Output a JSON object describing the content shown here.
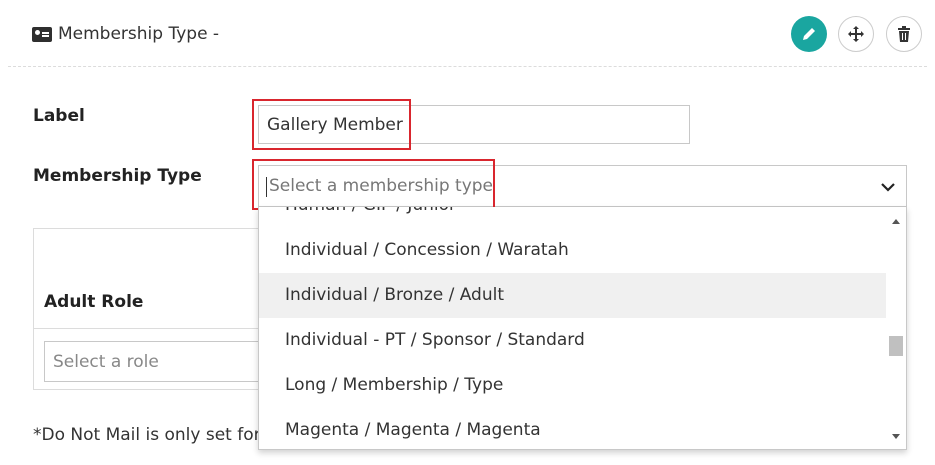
{
  "header": {
    "title": "Membership Type -",
    "icons": {
      "title": "id-card-icon",
      "edit": "pencil-icon",
      "move": "move-icon",
      "delete": "trash-icon"
    }
  },
  "form": {
    "label_label": "Label",
    "label_value": "Gallery Member",
    "membership_type_label": "Membership Type",
    "membership_type_placeholder": "Select a membership type"
  },
  "dropdown": {
    "options": [
      "Human / GIF / Junior",
      "Individual / Concession / Waratah",
      "Individual / Bronze / Adult",
      "Individual - PT / Sponsor / Standard",
      "Long / Membership / Type",
      "Magenta / Magenta / Magenta"
    ],
    "highlighted_option": "Individual / Bronze / Adult"
  },
  "roles": {
    "adult_role_label": "Adult Role",
    "role_placeholder": "Select a role"
  },
  "footnote": "*Do Not Mail is only set for",
  "colors": {
    "accent": "#1aa6a0",
    "highlight_box": "#d9262e"
  }
}
